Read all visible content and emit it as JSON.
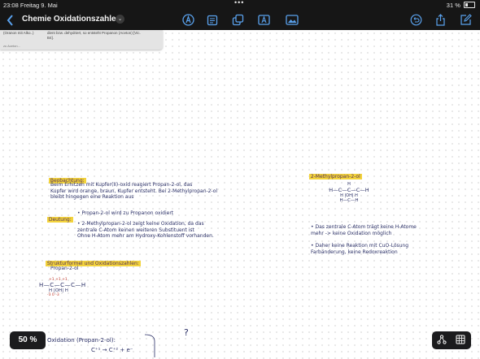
{
  "status": {
    "time": "23:08",
    "date": "Freitag 9. Mai",
    "more": "•••",
    "battery": "31 %"
  },
  "toolbar": {
    "back_icon": "chevron-left-icon",
    "title": "Chemie  Oxidationszahlen",
    "title_menu_icon": "chevron-down-icon",
    "tools": [
      "pen-circle-icon",
      "notes-icon",
      "shapes-icon",
      "text-box-icon",
      "image-icon"
    ],
    "actions": [
      "undo-icon",
      "share-icon",
      "compose-icon"
    ],
    "accent_color": "#5aa2ee"
  },
  "photo": {
    "left_text": "(Oranon mit Alko..)",
    "right_text": "dient bzw. dehydriert, so entsteht Propanon (Aceton) [Vic. B4].",
    "bottom_text": "zu Aceton..."
  },
  "notes": {
    "beobachtung_label": "Beobachtung:",
    "beobachtung_text": "Beim Erhitzen mit Kupfer(II)-oxid reagiert Propan-2-ol, das\nKupfer wird orange, braun, Kupfer entsteht. Bei 2-Methylpropan-2-ol\nbleibt hingegen eine Reaktion aus",
    "deutung_label": "Deutung:",
    "deutung_point1": "Propan-2-ol wird zu Propanon oxidiert",
    "deutung_point2": "2-Methylpropan-2-ol zeigt keine Oxidation, da das\nzentrale C-Atom keinen weiteren Substituent ist\nOhne H-Atom mehr am Hydroxy-Kohlenstoff vorhanden.",
    "strukturformel_label": "Strukturformel und Oxidationszahlen:",
    "propan_label": "Propan-2-ol",
    "methyl_label": "2-Methylpropan-2-ol",
    "right_point1": "Das zentrale C-Atom trägt keine H-Atome\nmehr -> keine Oxidation möglich",
    "right_point2": "Daher keine Reaktion mit CuO-Lösung\nFarbänderung, keine Redoxreaktion",
    "bottom_label": "Oxidation (Propan-2-ol):",
    "bottom_eq_left": "C⁺¹",
    "bottom_eq_arrow": "→",
    "bottom_eq_right": "C⁺² + e⁻",
    "question_mark": "?"
  },
  "molecule_propan": {
    "top_charges": "+1  +1  +1",
    "row": "H—C—C—C—H",
    "bottom": "H  |OH|  H",
    "ox_numbers": "-3   0   -3"
  },
  "molecule_methyl": {
    "top_h": "H",
    "row": "H—C—C—C—H",
    "mid": "H  |OH|  H",
    "bottom": "H—C—H"
  },
  "zoom": {
    "label": "50 %"
  },
  "bottom_right": {
    "icons": [
      "nodes-icon",
      "page-grid-icon"
    ]
  }
}
